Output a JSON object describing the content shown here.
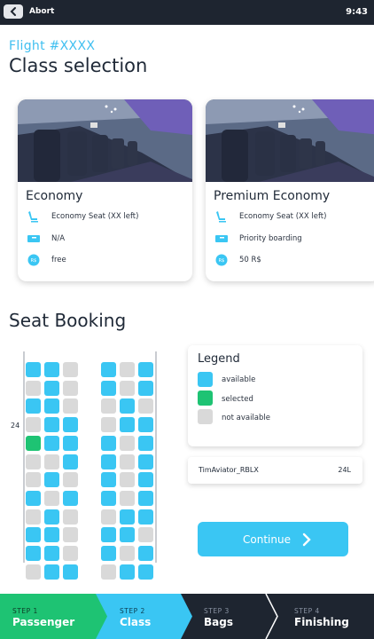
{
  "status_bar": {
    "back_label": "Abort",
    "time": "9:43"
  },
  "header": {
    "flight": "Flight #XXXX",
    "title": "Class selection"
  },
  "classes": [
    {
      "name": "Economy",
      "seat_text": "Economy Seat (XX left)",
      "boarding_text": "N/A",
      "price_text": "free"
    },
    {
      "name": "Premium Economy",
      "seat_text": "Economy Seat (XX left)",
      "boarding_text": "Priority  boarding",
      "price_text": "50 R$"
    }
  ],
  "seat_booking": {
    "title": "Seat Booking",
    "row_label": "24",
    "seats": [
      [
        "A",
        "A",
        "N",
        "A",
        "N",
        "A"
      ],
      [
        "N",
        "A",
        "N",
        "A",
        "N",
        "A"
      ],
      [
        "A",
        "A",
        "N",
        "N",
        "A",
        "N"
      ],
      [
        "N",
        "A",
        "A",
        "N",
        "A",
        "A"
      ],
      [
        "S",
        "A",
        "A",
        "A",
        "N",
        "A"
      ],
      [
        "N",
        "N",
        "A",
        "A",
        "N",
        "A"
      ],
      [
        "N",
        "A",
        "N",
        "A",
        "N",
        "A"
      ],
      [
        "A",
        "N",
        "A",
        "A",
        "N",
        "A"
      ],
      [
        "N",
        "A",
        "N",
        "N",
        "A",
        "A"
      ],
      [
        "A",
        "A",
        "N",
        "A",
        "A",
        "N"
      ],
      [
        "A",
        "A",
        "N",
        "A",
        "N",
        "A"
      ],
      [
        "N",
        "A",
        "A",
        "N",
        "A",
        "A"
      ]
    ]
  },
  "legend": {
    "title": "Legend",
    "items": [
      {
        "label": "available",
        "color": "#3ac6f3"
      },
      {
        "label": "selected",
        "color": "#1ec373"
      },
      {
        "label": "not available",
        "color": "#d9d9d9"
      }
    ]
  },
  "passenger": {
    "name": "TimAviator_RBLX",
    "seat": "24L"
  },
  "continue_label": "Continue",
  "steps": [
    {
      "step": "STEP 1",
      "name": "Passenger",
      "color": "#1ec373"
    },
    {
      "step": "STEP 2",
      "name": "Class",
      "color": "#3ac6f3"
    },
    {
      "step": "STEP 3",
      "name": "Bags",
      "color": "#1e2530"
    },
    {
      "step": "STEP 4",
      "name": "Finishing",
      "color": "#1e2530"
    }
  ]
}
